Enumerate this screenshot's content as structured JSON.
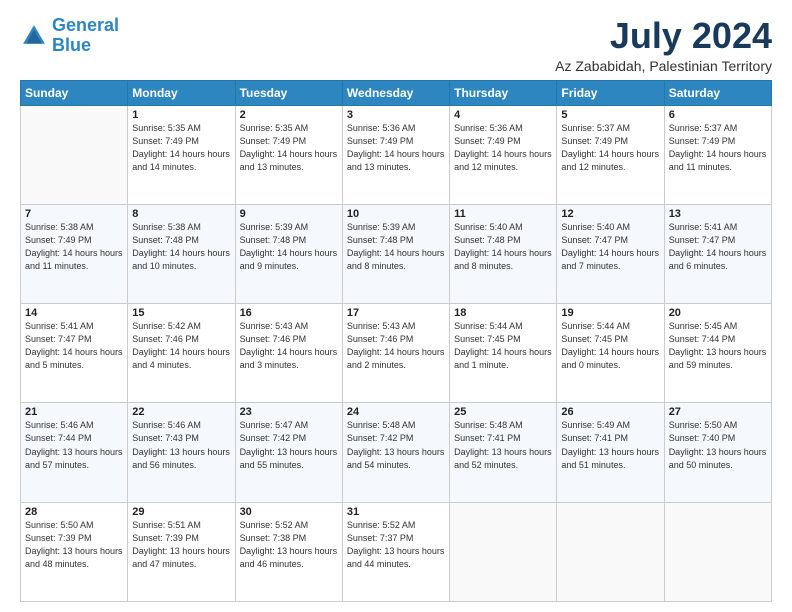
{
  "logo": {
    "line1": "General",
    "line2": "Blue"
  },
  "title": "July 2024",
  "location": "Az Zababidah, Palestinian Territory",
  "weekdays": [
    "Sunday",
    "Monday",
    "Tuesday",
    "Wednesday",
    "Thursday",
    "Friday",
    "Saturday"
  ],
  "days": [
    {
      "date": null,
      "number": ""
    },
    {
      "date": "1",
      "sunrise": "5:35 AM",
      "sunset": "7:49 PM",
      "daylight": "14 hours and 14 minutes."
    },
    {
      "date": "2",
      "sunrise": "5:35 AM",
      "sunset": "7:49 PM",
      "daylight": "14 hours and 13 minutes."
    },
    {
      "date": "3",
      "sunrise": "5:36 AM",
      "sunset": "7:49 PM",
      "daylight": "14 hours and 13 minutes."
    },
    {
      "date": "4",
      "sunrise": "5:36 AM",
      "sunset": "7:49 PM",
      "daylight": "14 hours and 12 minutes."
    },
    {
      "date": "5",
      "sunrise": "5:37 AM",
      "sunset": "7:49 PM",
      "daylight": "14 hours and 12 minutes."
    },
    {
      "date": "6",
      "sunrise": "5:37 AM",
      "sunset": "7:49 PM",
      "daylight": "14 hours and 11 minutes."
    },
    {
      "date": "7",
      "sunrise": "5:38 AM",
      "sunset": "7:49 PM",
      "daylight": "14 hours and 11 minutes."
    },
    {
      "date": "8",
      "sunrise": "5:38 AM",
      "sunset": "7:48 PM",
      "daylight": "14 hours and 10 minutes."
    },
    {
      "date": "9",
      "sunrise": "5:39 AM",
      "sunset": "7:48 PM",
      "daylight": "14 hours and 9 minutes."
    },
    {
      "date": "10",
      "sunrise": "5:39 AM",
      "sunset": "7:48 PM",
      "daylight": "14 hours and 8 minutes."
    },
    {
      "date": "11",
      "sunrise": "5:40 AM",
      "sunset": "7:48 PM",
      "daylight": "14 hours and 8 minutes."
    },
    {
      "date": "12",
      "sunrise": "5:40 AM",
      "sunset": "7:47 PM",
      "daylight": "14 hours and 7 minutes."
    },
    {
      "date": "13",
      "sunrise": "5:41 AM",
      "sunset": "7:47 PM",
      "daylight": "14 hours and 6 minutes."
    },
    {
      "date": "14",
      "sunrise": "5:41 AM",
      "sunset": "7:47 PM",
      "daylight": "14 hours and 5 minutes."
    },
    {
      "date": "15",
      "sunrise": "5:42 AM",
      "sunset": "7:46 PM",
      "daylight": "14 hours and 4 minutes."
    },
    {
      "date": "16",
      "sunrise": "5:43 AM",
      "sunset": "7:46 PM",
      "daylight": "14 hours and 3 minutes."
    },
    {
      "date": "17",
      "sunrise": "5:43 AM",
      "sunset": "7:46 PM",
      "daylight": "14 hours and 2 minutes."
    },
    {
      "date": "18",
      "sunrise": "5:44 AM",
      "sunset": "7:45 PM",
      "daylight": "14 hours and 1 minute."
    },
    {
      "date": "19",
      "sunrise": "5:44 AM",
      "sunset": "7:45 PM",
      "daylight": "14 hours and 0 minutes."
    },
    {
      "date": "20",
      "sunrise": "5:45 AM",
      "sunset": "7:44 PM",
      "daylight": "13 hours and 59 minutes."
    },
    {
      "date": "21",
      "sunrise": "5:46 AM",
      "sunset": "7:44 PM",
      "daylight": "13 hours and 57 minutes."
    },
    {
      "date": "22",
      "sunrise": "5:46 AM",
      "sunset": "7:43 PM",
      "daylight": "13 hours and 56 minutes."
    },
    {
      "date": "23",
      "sunrise": "5:47 AM",
      "sunset": "7:42 PM",
      "daylight": "13 hours and 55 minutes."
    },
    {
      "date": "24",
      "sunrise": "5:48 AM",
      "sunset": "7:42 PM",
      "daylight": "13 hours and 54 minutes."
    },
    {
      "date": "25",
      "sunrise": "5:48 AM",
      "sunset": "7:41 PM",
      "daylight": "13 hours and 52 minutes."
    },
    {
      "date": "26",
      "sunrise": "5:49 AM",
      "sunset": "7:41 PM",
      "daylight": "13 hours and 51 minutes."
    },
    {
      "date": "27",
      "sunrise": "5:50 AM",
      "sunset": "7:40 PM",
      "daylight": "13 hours and 50 minutes."
    },
    {
      "date": "28",
      "sunrise": "5:50 AM",
      "sunset": "7:39 PM",
      "daylight": "13 hours and 48 minutes."
    },
    {
      "date": "29",
      "sunrise": "5:51 AM",
      "sunset": "7:39 PM",
      "daylight": "13 hours and 47 minutes."
    },
    {
      "date": "30",
      "sunrise": "5:52 AM",
      "sunset": "7:38 PM",
      "daylight": "13 hours and 46 minutes."
    },
    {
      "date": "31",
      "sunrise": "5:52 AM",
      "sunset": "7:37 PM",
      "daylight": "13 hours and 44 minutes."
    }
  ]
}
